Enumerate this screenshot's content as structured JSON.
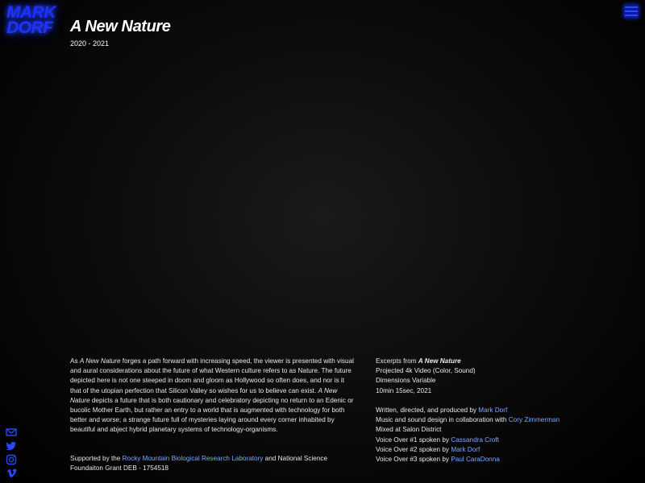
{
  "logo": {
    "line1": "MARK",
    "line2": "DORF",
    "color": "#1e33ff"
  },
  "header": {
    "title": "A New Nature",
    "years": "2020 - 2021"
  },
  "menu": {
    "icon": "hamburger-menu-icon"
  },
  "social": [
    "email-icon",
    "twitter-icon",
    "instagram-icon",
    "vimeo-icon"
  ],
  "description": {
    "p1_a": "As ",
    "p1_em1": "A New Nature",
    "p1_b": " forges a path forward with increasing speed, the viewer is presented with visual and aural considerations about the future of what Western culture refers to as Nature. The future depicted here is not one steeped in doom and gloom as Hollywood so often does, and nor is it that of the utopian perfection that Silicon Valley so wishes for us to believe can exist. ",
    "p1_em2": "A New Nature",
    "p1_c": " depicts a future that is both cautionary and celebratory depicting no return to an Edenic or bucolic Mother Earth, but rather an entry to a world that is augmented with technology for both better and worse; a strange future full of mysteries laying around every corner inhabited by beautiful and abject hybrid planetary systems of technology-organisms."
  },
  "support": {
    "prefix": "Supported by the ",
    "link": "Rocky Mountain Biological Research Laboratory",
    "suffix": " and National Science Foundaiton Grant DEB - 1754518"
  },
  "credits": {
    "excerpts_prefix": "Excerpts from ",
    "excerpts_title": "A New Nature",
    "medium": "Projected 4k Video (Color, Sound)",
    "dimensions": "Dimensions Variable",
    "duration": "10min 15sec, 2021",
    "written_prefix": "Written, directed, and produced by ",
    "written_link": "Mark Dorf",
    "music_prefix": "Music and sound design in collaboration with ",
    "music_link": "Cory Zimmerman",
    "mixed": "Mixed at Salon District",
    "vo1_prefix": "Voice Over #1 spoken by ",
    "vo1_link": "Cassandra Croft",
    "vo2_prefix": "Voice Over #2 spoken by ",
    "vo2_link": "Mark Dorf",
    "vo3_prefix": "Voice Over #3 spoken by ",
    "vo3_link": "Paul CaraDonna"
  }
}
